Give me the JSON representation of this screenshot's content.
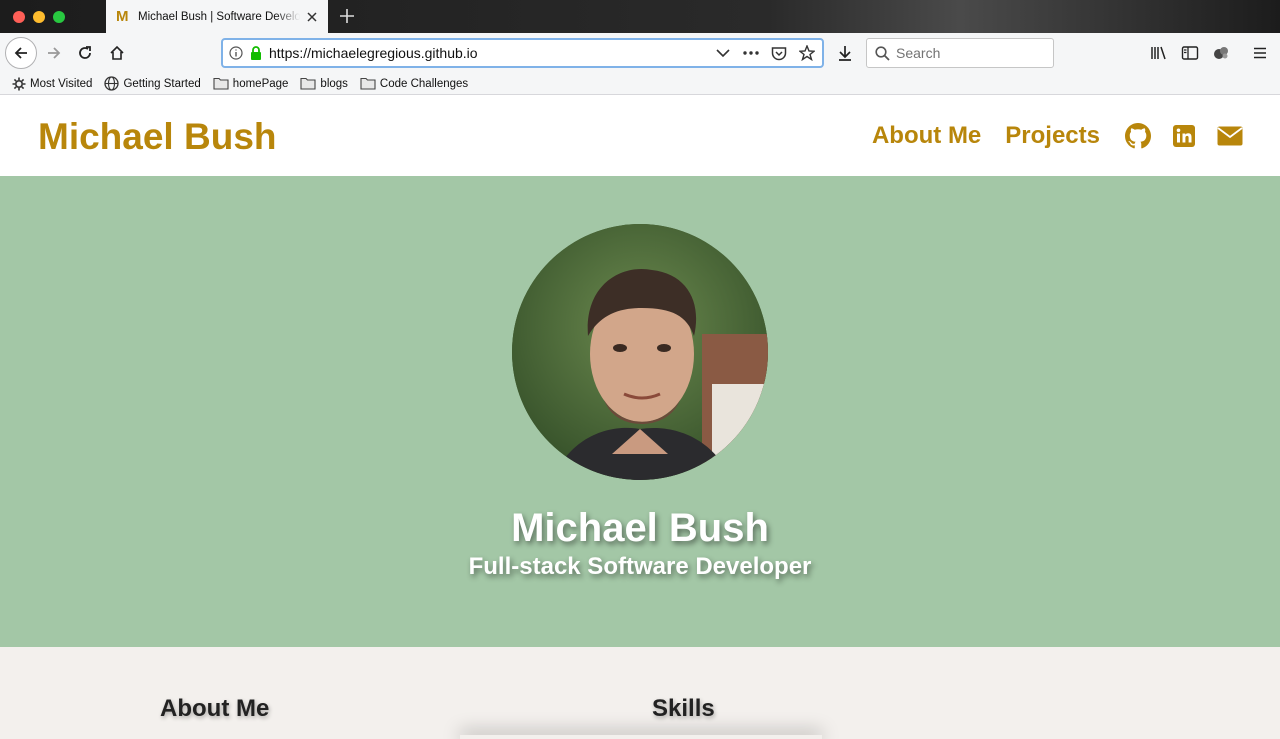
{
  "browser": {
    "tab_title": "Michael Bush | Software Developer",
    "tab_favicon": "M",
    "url": "https://michaelegregious.github.io",
    "search_placeholder": "Search",
    "bookmarks": [
      {
        "label": "Most Visited",
        "icon": "gear-icon"
      },
      {
        "label": "Getting Started",
        "icon": "globe-icon"
      },
      {
        "label": "homePage",
        "icon": "folder-icon"
      },
      {
        "label": "blogs",
        "icon": "folder-icon"
      },
      {
        "label": "Code Challenges",
        "icon": "folder-icon"
      }
    ]
  },
  "site": {
    "brand": "Michael Bush",
    "nav": {
      "about": "About Me",
      "projects": "Projects",
      "social": [
        "github-icon",
        "linkedin-icon",
        "envelope-icon"
      ]
    },
    "hero": {
      "name": "Michael Bush",
      "subtitle": "Full-stack Software Developer"
    },
    "sections": {
      "about_title": "About Me",
      "skills_title": "Skills"
    },
    "colors": {
      "accent": "#b8860b",
      "hero_bg": "#a3c7a6",
      "section_bg": "#f3f0ed"
    }
  }
}
